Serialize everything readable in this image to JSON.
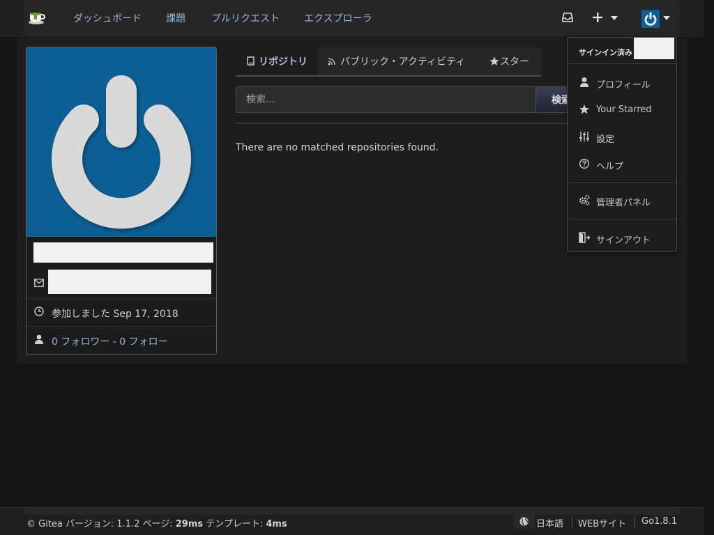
{
  "nav": {
    "logo": "gitea-teacup-logo",
    "links": [
      "ダッシュボード",
      "課題",
      "プルリクエスト",
      "エクスプローラ"
    ],
    "icons": [
      "inbox-icon",
      "plus-icon",
      "avatar-power-icon"
    ]
  },
  "profile": {
    "avatar_color": "#0c5f95",
    "joined_label": "参加しました Sep 17, 2018",
    "followers_label": "0 フォロワー - 0 フォロー"
  },
  "tabs": [
    {
      "label": "リポジトリ",
      "icon": "book-icon",
      "active": true
    },
    {
      "label": "パブリック・アクティビティ",
      "icon": "rss-icon",
      "active": false
    },
    {
      "label": "スター",
      "icon": "star-icon",
      "active": false
    }
  ],
  "search": {
    "placeholder": "検索...",
    "button": "検索"
  },
  "results": {
    "empty_message": "There are no matched repositories found."
  },
  "dropdown": {
    "header": "サインイン済み",
    "items": [
      {
        "label": "プロフィール",
        "icon": "person-icon"
      },
      {
        "label": "Your Starred",
        "icon": "star-icon"
      },
      {
        "label": "設定",
        "icon": "settings-sliders-icon"
      },
      {
        "label": "ヘルプ",
        "icon": "help-circle-icon"
      },
      {
        "label": "管理者パネル",
        "icon": "gears-icon"
      },
      {
        "label": "サインアウト",
        "icon": "sign-out-icon"
      }
    ]
  },
  "footer": {
    "copyright_prefix": "© Gitea バージョン: 1.1.2 ページ: ",
    "page_time": "29ms",
    "template_prefix": " テンプレート: ",
    "template_time": "4ms",
    "language": "日本語",
    "website": "WEBサイト",
    "go_version": "Go1.8.1"
  },
  "colors": {
    "accent_link": "#9bb7dd",
    "background": "#161616",
    "avatar_blue": "#0c5f95"
  }
}
